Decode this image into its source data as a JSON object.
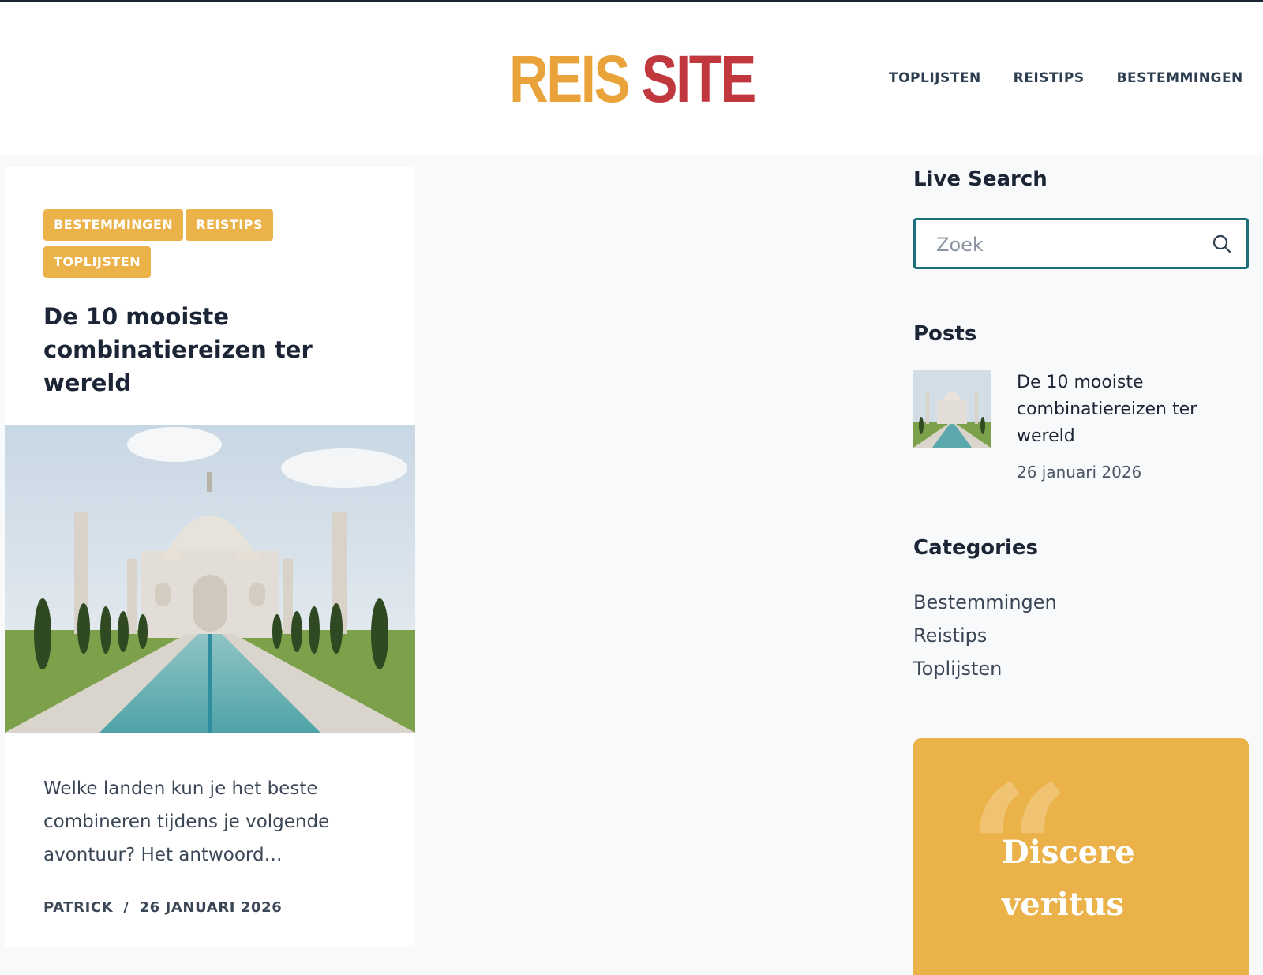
{
  "header": {
    "logo_word1": "REIS",
    "logo_word2": "SITE",
    "nav": [
      "TOPLIJSTEN",
      "REISTIPS",
      "BESTEMMINGEN"
    ]
  },
  "post": {
    "tags": [
      "BESTEMMINGEN",
      "REISTIPS",
      "TOPLIJSTEN"
    ],
    "title": "De 10 mooiste combinatiereizen ter wereld",
    "excerpt": "Welke landen kun je het beste combineren tijdens je volgende avontuur? Het antwoord…",
    "author": "PATRICK",
    "separator": "/",
    "date": "26 JANUARI 2026"
  },
  "sidebar": {
    "search_title": "Live Search",
    "search_placeholder": "Zoek",
    "posts_title": "Posts",
    "recent_post_title": "De 10 mooiste combinatiereizen ter wereld",
    "recent_post_date": "26 januari 2026",
    "categories_title": "Categories",
    "categories": [
      "Bestemmingen",
      "Reistips",
      "Toplijsten"
    ],
    "quote_text": "Discere veritus"
  },
  "colors": {
    "accent_orange": "#ebb24a",
    "logo_orange": "#e9a33a",
    "logo_red": "#c0383e",
    "search_border": "#1a6f7a",
    "text_dark": "#1b2535"
  },
  "icons": [
    "search-icon",
    "quote-icon"
  ]
}
